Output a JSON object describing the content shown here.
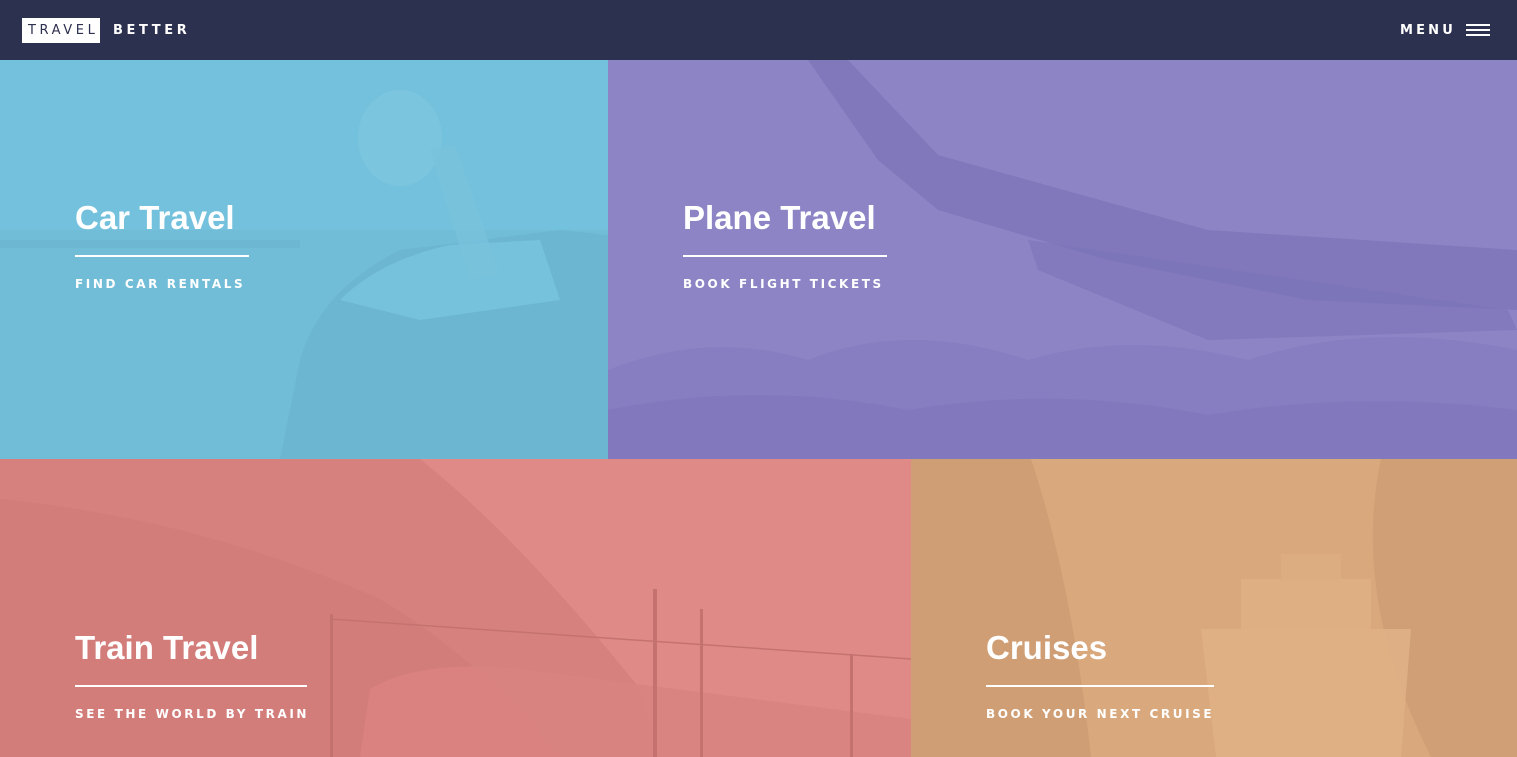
{
  "header": {
    "logo_box": "TRAVEL",
    "logo_rest": "BETTER",
    "menu_label": "MENU",
    "menu_icon": "hamburger-icon"
  },
  "tiles": [
    {
      "title": "Car Travel",
      "subtitle": "FIND CAR RENTALS",
      "color": "#74c1dd"
    },
    {
      "title": "Plane Travel",
      "subtitle": "BOOK FLIGHT TICKETS",
      "color": "#8c84c4"
    },
    {
      "title": "Train Travel",
      "subtitle": "SEE THE WORLD BY TRAIN",
      "color": "#e08a88"
    },
    {
      "title": "Cruises",
      "subtitle": "BOOK YOUR NEXT CRUISE",
      "color": "#d9a87c"
    }
  ],
  "colors": {
    "header_bg": "#2d3150"
  }
}
